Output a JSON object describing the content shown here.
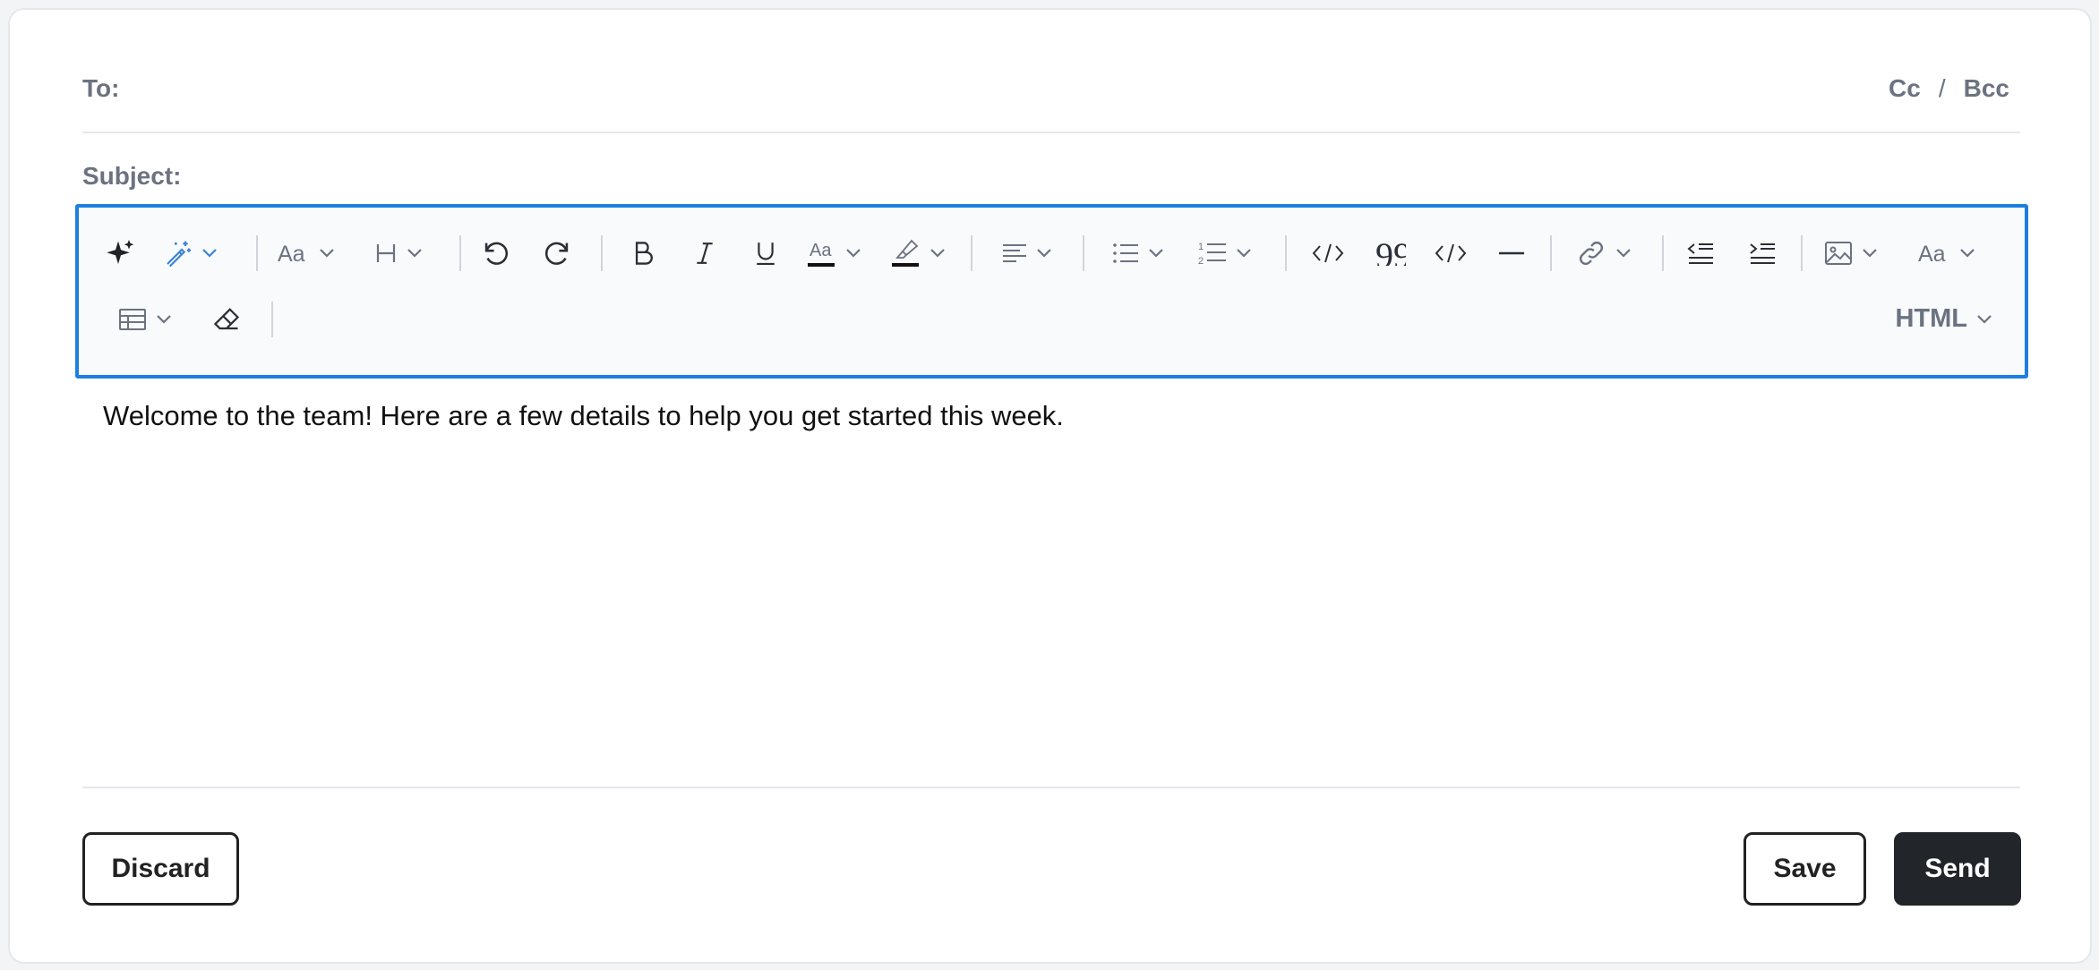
{
  "compose": {
    "to_label": "To:",
    "cc_label": "Cc",
    "separator": "/",
    "bcc_label": "Bcc",
    "subject_label": "Subject:",
    "body_text": "Welcome to the team! Here are a few details to help you get started this week."
  },
  "toolbar": {
    "accent_color": "#1e7fe0",
    "format_mode": "HTML",
    "tools": [
      "ai-sparkle-icon",
      "magic-wand-icon",
      "font-family-icon",
      "heading-icon",
      "undo-icon",
      "redo-icon",
      "bold-icon",
      "italic-icon",
      "underline-icon",
      "text-color-icon",
      "highlight-icon",
      "align-icon",
      "bullet-list-icon",
      "numbered-list-icon",
      "code-view-icon",
      "blockquote-icon",
      "code-icon",
      "horizontal-rule-icon",
      "link-icon",
      "outdent-icon",
      "indent-icon",
      "image-icon",
      "font-size-icon",
      "table-icon",
      "eraser-icon"
    ]
  },
  "actions": {
    "discard_label": "Discard",
    "save_label": "Save",
    "send_label": "Send"
  }
}
